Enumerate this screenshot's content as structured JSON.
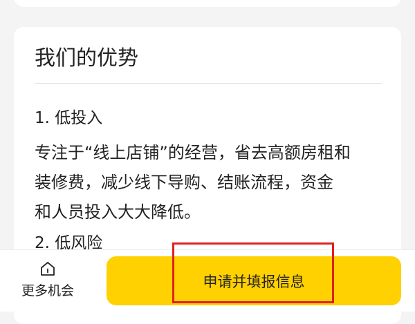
{
  "advantages": {
    "title": "我们的优势",
    "points": [
      {
        "heading": "1. 低投入",
        "body_lines": [
          "专注于“线上店铺”的经营，省去高额房租和",
          "装修费，减少线下导购、结账流程，资金",
          "和人员投入大大降低。"
        ]
      },
      {
        "heading": "2. 低风险"
      }
    ]
  },
  "bottom_bar": {
    "more_label": "更多机会",
    "more_icon": "home-icon",
    "apply_label": "申请并填报信息"
  },
  "colors": {
    "accent": "#ffd100",
    "highlight": "#e02020",
    "background": "#f4f4f4"
  }
}
